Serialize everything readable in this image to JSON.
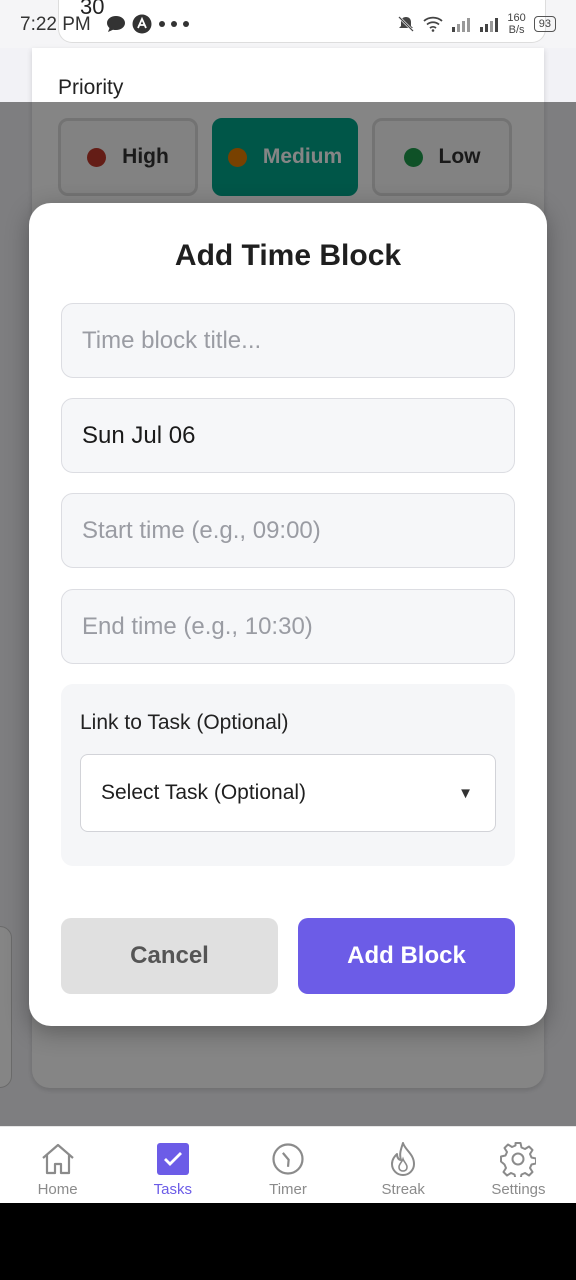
{
  "status_bar": {
    "time": "7:22 PM",
    "speed_value": "160",
    "speed_unit": "B/s",
    "battery": "93",
    "overlap_number": "30"
  },
  "form": {
    "priority_label": "Priority",
    "priority_options": [
      {
        "label": "High",
        "dot_color": "#d63031"
      },
      {
        "label": "Medium",
        "dot_color": "#e67e00",
        "selected": true
      },
      {
        "label": "Low",
        "dot_color": "#1e9c4c"
      }
    ]
  },
  "modal": {
    "title": "Add Time Block",
    "title_placeholder": "Time block title...",
    "date_value": "Sun Jul 06",
    "start_placeholder": "Start time (e.g., 09:00)",
    "end_placeholder": "End time (e.g., 10:30)",
    "link_label": "Link to Task (Optional)",
    "select_value": "Select Task (Optional)",
    "select_chevron": "▼",
    "cancel_label": "Cancel",
    "add_label": "Add Block"
  },
  "nav": {
    "items": [
      {
        "label": "Home",
        "icon": "home-icon"
      },
      {
        "label": "Tasks",
        "icon": "tasks-checkbox-icon",
        "active": true
      },
      {
        "label": "Timer",
        "icon": "timer-icon"
      },
      {
        "label": "Streak",
        "icon": "flame-icon"
      },
      {
        "label": "Settings",
        "icon": "gear-icon"
      }
    ]
  },
  "colors": {
    "accent": "#6c5ce7",
    "medium_selected": "#00a58a"
  }
}
